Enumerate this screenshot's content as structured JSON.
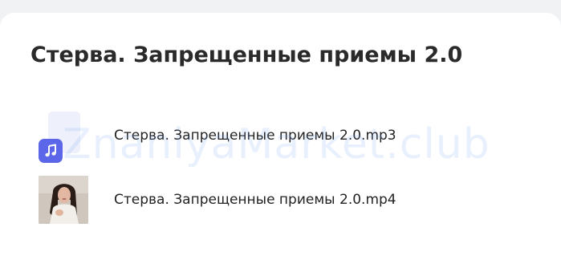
{
  "page": {
    "title": "Стерва. Запрещенные приемы 2.0"
  },
  "files": [
    {
      "name": "Стерва. Запрещенные приемы 2.0.mp3",
      "type": "audio",
      "icon": "music-note-icon",
      "badge_color": "#5b66e8"
    },
    {
      "name": "Стерва. Запрещенные приемы 2.0.mp4",
      "type": "video",
      "icon": "video-thumbnail"
    }
  ],
  "watermark": {
    "text": "ZnaniyaMarket.club"
  }
}
